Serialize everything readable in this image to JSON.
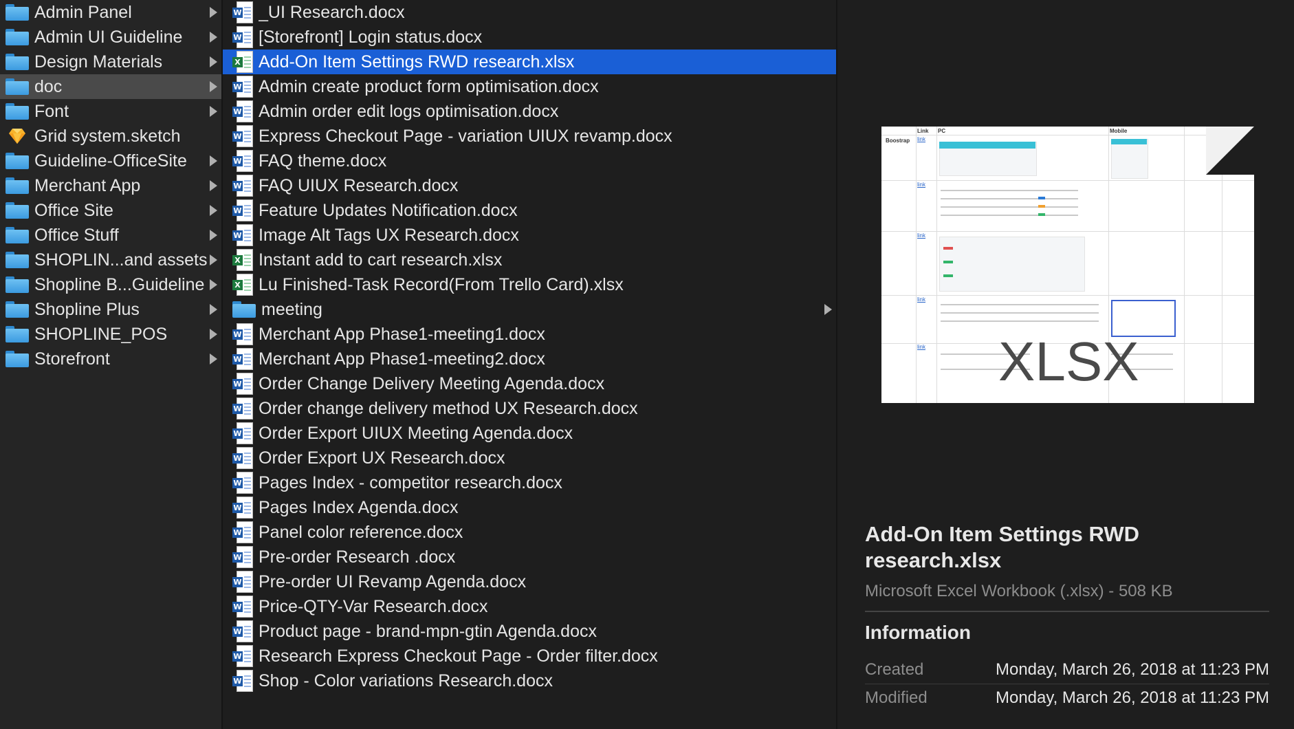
{
  "folders": [
    {
      "label": "Admin Panel",
      "icon": "folder-icon",
      "arrow": true,
      "selected": false
    },
    {
      "label": "Admin UI Guideline",
      "icon": "folder-icon",
      "arrow": true,
      "selected": false
    },
    {
      "label": "Design Materials",
      "icon": "folder-icon",
      "arrow": true,
      "selected": false
    },
    {
      "label": "doc",
      "icon": "folder-icon",
      "arrow": true,
      "selected": true
    },
    {
      "label": "Font",
      "icon": "folder-icon",
      "arrow": true,
      "selected": false
    },
    {
      "label": "Grid system.sketch",
      "icon": "sketch-file-icon",
      "arrow": false,
      "selected": false
    },
    {
      "label": "Guideline-OfficeSite",
      "icon": "folder-icon",
      "arrow": true,
      "selected": false
    },
    {
      "label": "Merchant App",
      "icon": "folder-icon",
      "arrow": true,
      "selected": false
    },
    {
      "label": "Office Site",
      "icon": "folder-icon",
      "arrow": true,
      "selected": false
    },
    {
      "label": "Office Stuff",
      "icon": "folder-icon",
      "arrow": true,
      "selected": false
    },
    {
      "label": "SHOPLIN...and assets",
      "icon": "folder-icon",
      "arrow": true,
      "selected": false
    },
    {
      "label": "Shopline B...Guideline",
      "icon": "folder-icon",
      "arrow": true,
      "selected": false
    },
    {
      "label": "Shopline Plus",
      "icon": "folder-icon",
      "arrow": true,
      "selected": false
    },
    {
      "label": "SHOPLINE_POS",
      "icon": "folder-icon",
      "arrow": true,
      "selected": false
    },
    {
      "label": "Storefront",
      "icon": "folder-icon",
      "arrow": true,
      "selected": false
    }
  ],
  "files": [
    {
      "label": "_UI Research.docx",
      "type": "docx",
      "selected": false
    },
    {
      "label": "[Storefront] Login status.docx",
      "type": "docx",
      "selected": false
    },
    {
      "label": "Add-On Item Settings RWD research.xlsx",
      "type": "xlsx",
      "selected": true
    },
    {
      "label": "Admin create product form optimisation.docx",
      "type": "docx",
      "selected": false
    },
    {
      "label": "Admin order edit logs optimisation.docx",
      "type": "docx",
      "selected": false
    },
    {
      "label": "Express Checkout Page - variation UIUX revamp.docx",
      "type": "docx",
      "selected": false
    },
    {
      "label": "FAQ theme.docx",
      "type": "docx",
      "selected": false
    },
    {
      "label": "FAQ UIUX Research.docx",
      "type": "docx",
      "selected": false
    },
    {
      "label": "Feature Updates Notification.docx",
      "type": "docx",
      "selected": false
    },
    {
      "label": "Image Alt Tags UX Research.docx",
      "type": "docx",
      "selected": false
    },
    {
      "label": "Instant add to cart research.xlsx",
      "type": "xlsx",
      "selected": false
    },
    {
      "label": "Lu Finished-Task Record(From Trello Card).xlsx",
      "type": "xlsx",
      "selected": false
    },
    {
      "label": "meeting",
      "type": "folder",
      "selected": false
    },
    {
      "label": "Merchant App Phase1-meeting1.docx",
      "type": "docx",
      "selected": false
    },
    {
      "label": "Merchant App Phase1-meeting2.docx",
      "type": "docx",
      "selected": false
    },
    {
      "label": "Order Change Delivery Meeting Agenda.docx",
      "type": "docx",
      "selected": false
    },
    {
      "label": "Order change delivery method UX Research.docx",
      "type": "docx",
      "selected": false
    },
    {
      "label": "Order Export UIUX Meeting Agenda.docx",
      "type": "docx",
      "selected": false
    },
    {
      "label": "Order Export UX Research.docx",
      "type": "docx",
      "selected": false
    },
    {
      "label": "Pages Index - competitor research.docx",
      "type": "docx",
      "selected": false
    },
    {
      "label": "Pages Index Agenda.docx",
      "type": "docx",
      "selected": false
    },
    {
      "label": "Panel color reference.docx",
      "type": "docx",
      "selected": false
    },
    {
      "label": "Pre-order Research .docx",
      "type": "docx",
      "selected": false
    },
    {
      "label": "Pre-order UI Revamp Agenda.docx",
      "type": "docx",
      "selected": false
    },
    {
      "label": "Price-QTY-Var Research.docx",
      "type": "docx",
      "selected": false
    },
    {
      "label": "Product page - brand-mpn-gtin  Agenda.docx",
      "type": "docx",
      "selected": false
    },
    {
      "label": "Research Express Checkout Page - Order filter.docx",
      "type": "docx",
      "selected": false
    },
    {
      "label": "Shop - Color variations Research.docx",
      "type": "docx",
      "selected": false
    }
  ],
  "preview": {
    "thumbnail_label": "XLSX",
    "title": "Add-On Item Settings RWD research.xlsx",
    "subtitle": "Microsoft Excel Workbook (.xlsx) - 508 KB",
    "info_heading": "Information",
    "created_label": "Created",
    "created_value": "Monday, March 26, 2018 at 11:23 PM",
    "modified_label": "Modified",
    "modified_value": "Monday, March 26, 2018 at 11:23 PM"
  },
  "colors": {
    "selection_blue": "#1a5fd6",
    "folder_blue": "#4aa8ea",
    "background": "#1e1e1e"
  }
}
